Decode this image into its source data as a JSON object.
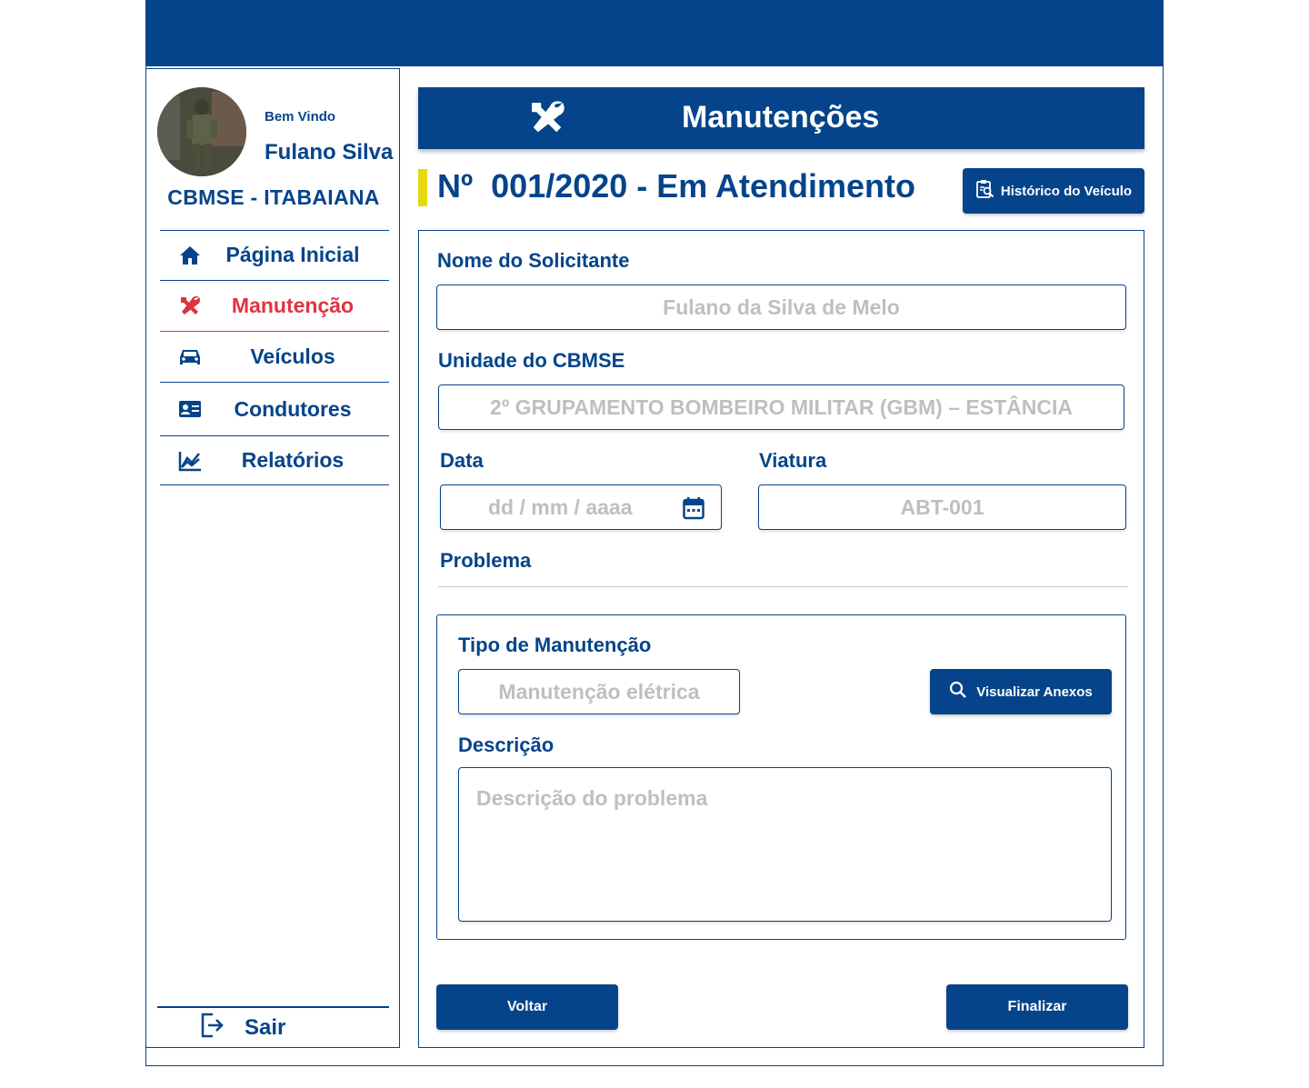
{
  "user": {
    "welcome": "Bem Vindo",
    "name": "Fulano Silva",
    "unit": "CBMSE - ITABAIANA"
  },
  "nav": {
    "items": [
      {
        "label": "Página Inicial",
        "icon": "home-icon"
      },
      {
        "label": "Manutenção",
        "icon": "tools-icon",
        "active": true
      },
      {
        "label": "Veículos",
        "icon": "car-icon"
      },
      {
        "label": "Condutores",
        "icon": "id-card-icon"
      },
      {
        "label": "Relatórios",
        "icon": "chart-icon"
      }
    ],
    "logout": "Sair"
  },
  "header": {
    "title": "Manutenções"
  },
  "order": {
    "title": "Nº  001/2020 - Em Atendimento",
    "history_button": "Histórico do Veículo"
  },
  "form": {
    "requester_label": "Nome do Solicitante",
    "requester_value": "Fulano da Silva de Melo",
    "unit_label": "Unidade do CBMSE",
    "unit_value": "2º GRUPAMENTO BOMBEIRO MILITAR (GBM) – ESTÂNCIA",
    "date_label": "Data",
    "date_placeholder": "dd / mm / aaaa",
    "vehicle_label": "Viatura",
    "vehicle_value": "ABT-001",
    "problem_label": "Problema",
    "type_label": "Tipo de Manutenção",
    "type_value": "Manutenção elétrica",
    "attachments_button": "Visualizar Anexos",
    "description_label": "Descrição",
    "description_placeholder": "Descrição do problema"
  },
  "actions": {
    "back": "Voltar",
    "finish": "Finalizar"
  },
  "colors": {
    "primary": "#05448a",
    "active": "#e03340",
    "status_mark": "#e5d80f",
    "placeholder": "#bfbfbf"
  }
}
